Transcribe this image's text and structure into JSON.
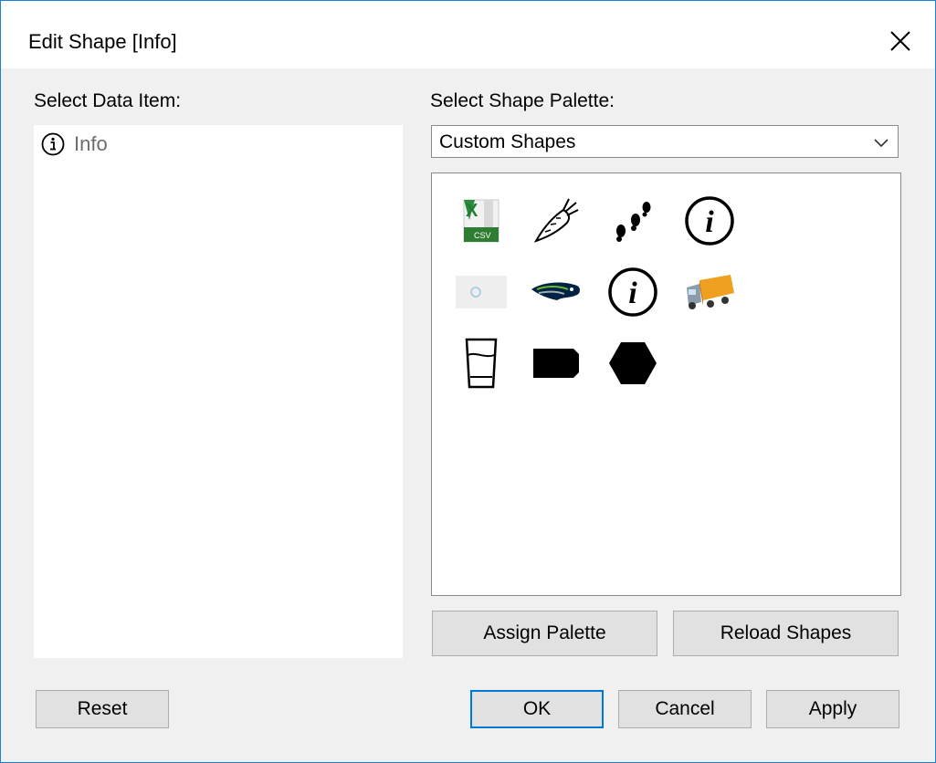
{
  "window": {
    "title": "Edit Shape [Info]",
    "close_glyph": "✕"
  },
  "left_panel": {
    "label": "Select Data Item:",
    "items": [
      {
        "label": "Info",
        "icon": "info-circle-icon"
      }
    ]
  },
  "right_panel": {
    "palette_label": "Select Shape Palette:",
    "palette_selected": "Custom Shapes",
    "shapes": [
      {
        "icon": "excel-csv-icon",
        "csv_text": "CSV"
      },
      {
        "icon": "carrot-icon"
      },
      {
        "icon": "footprints-icon"
      },
      {
        "icon": "info-circle-icon",
        "glyph": "i"
      },
      {
        "icon": "loading-thumbnail-icon"
      },
      {
        "icon": "seahawks-logo-icon"
      },
      {
        "icon": "info-circle-icon",
        "glyph": "i"
      },
      {
        "icon": "delivery-truck-icon"
      },
      {
        "icon": "drinking-glass-icon"
      },
      {
        "icon": "rounded-rectangle-icon"
      },
      {
        "icon": "hexagon-icon"
      }
    ],
    "assign_palette_label": "Assign Palette",
    "reload_shapes_label": "Reload Shapes"
  },
  "footer": {
    "reset_label": "Reset",
    "ok_label": "OK",
    "cancel_label": "Cancel",
    "apply_label": "Apply"
  },
  "colors": {
    "accent": "#0078d7",
    "window_border": "#1883d7",
    "dialog_bg": "#f0f0f0",
    "excel_green": "#1e7e34",
    "truck_orange": "#f0a020",
    "seahawks_navy": "#002244"
  }
}
